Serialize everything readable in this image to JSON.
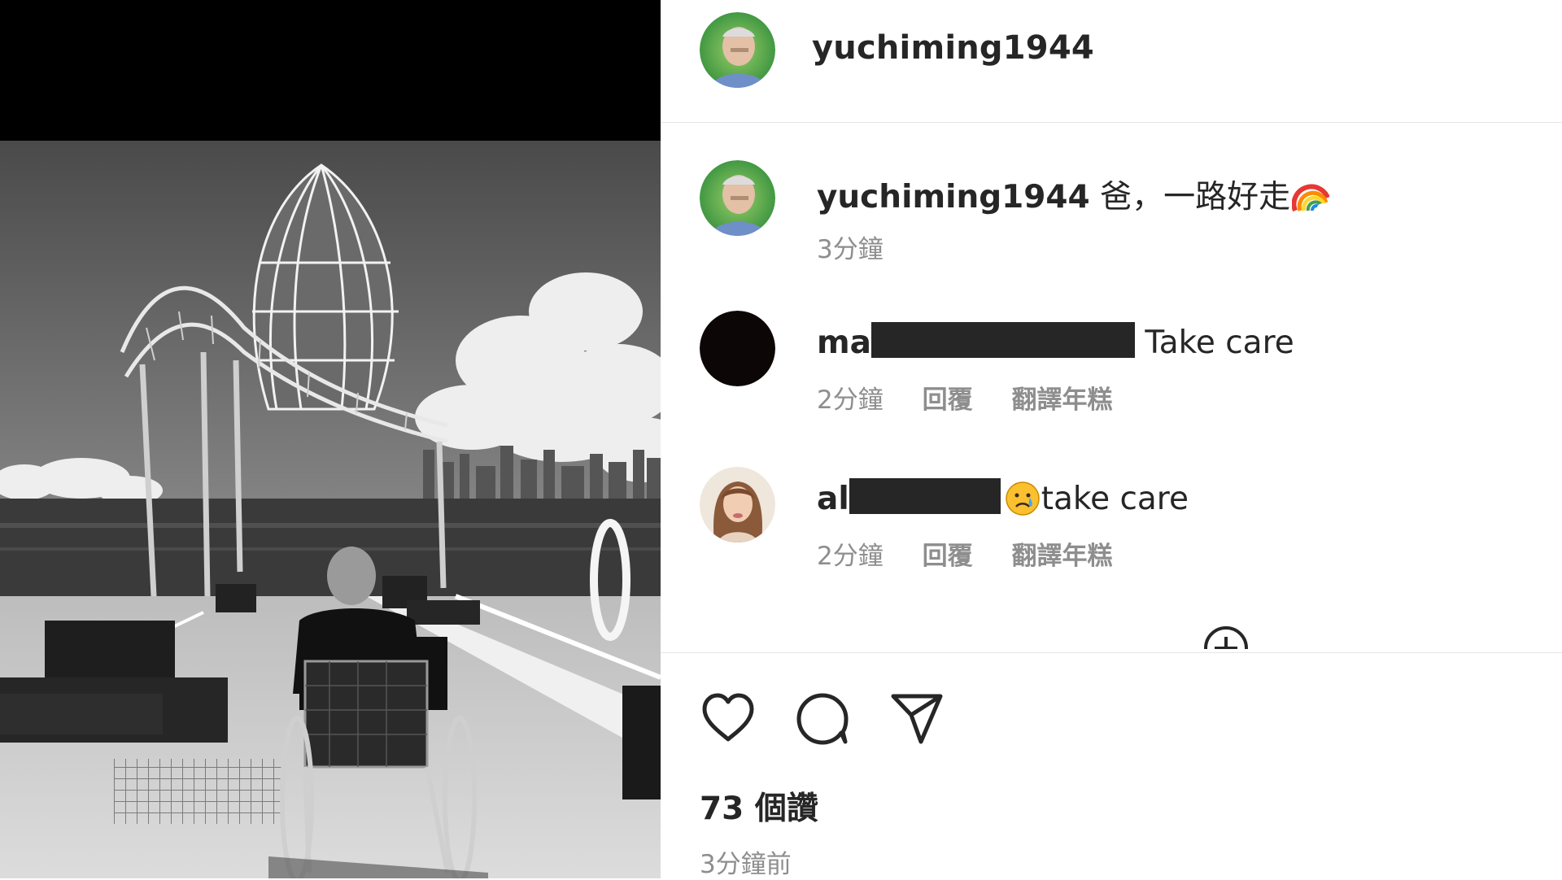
{
  "post": {
    "username": "yuchiming1944",
    "caption": "爸，一路好走",
    "caption_emoji": "rainbow",
    "caption_time": "3分鐘",
    "image_alt": "Black and white photo of a man in a wheelchair on a pier facing a large sculpture and harbour skyline"
  },
  "comments": [
    {
      "user_visible": "ma",
      "redacted": true,
      "text": "Take care",
      "time": "2分鐘",
      "reply_label": "回覆",
      "translate_label": "翻譯年糕",
      "avatar": "black-circle-avatar"
    },
    {
      "user_visible": "al",
      "redacted": true,
      "emoji": "crying-face",
      "text": "take care",
      "time": "2分鐘",
      "reply_label": "回覆",
      "translate_label": "翻譯年糕",
      "avatar": "woman-portrait-avatar"
    }
  ],
  "actions": {
    "icons": [
      "heart-icon",
      "comment-bubble-icon",
      "share-paper-plane-icon"
    ],
    "likes_label": "73 個讚",
    "posted_ago": "3分鐘前"
  },
  "colors": {
    "text_primary": "#262626",
    "text_secondary": "#8e8e8e",
    "divider": "#e6e6e6",
    "redaction": "#262626"
  }
}
